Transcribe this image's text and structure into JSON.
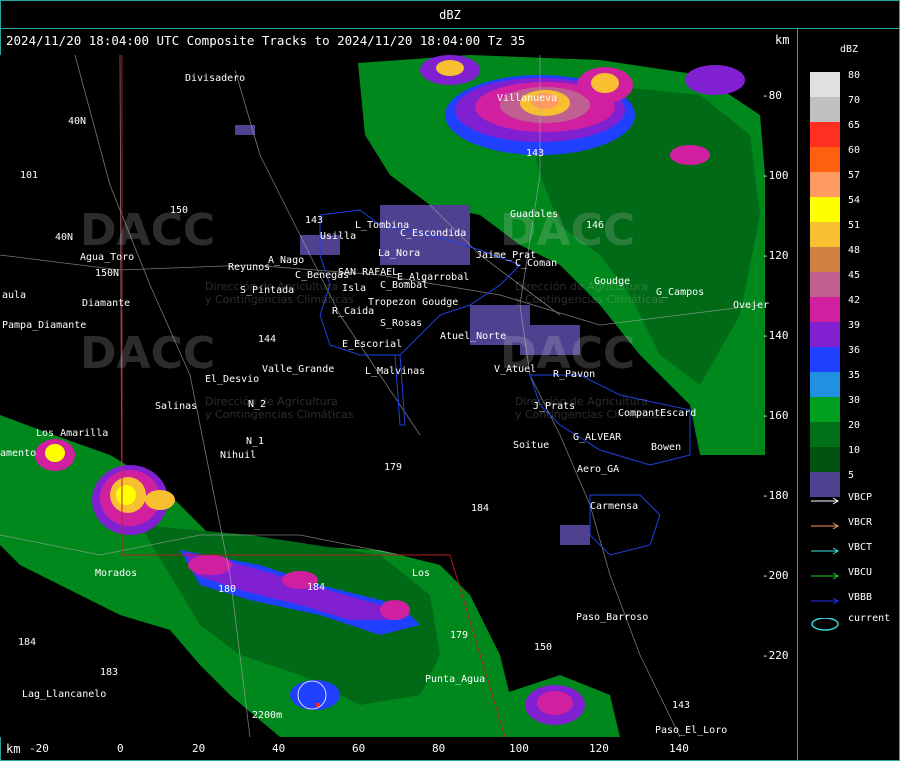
{
  "title_bar": "dBZ",
  "header": "2024/11/20 18:04:00 UTC Composite Tracks to 2024/11/20 18:04:00 Tz 35",
  "axis_unit": "km",
  "y_ticks": [
    "-80",
    "-100",
    "-120",
    "-140",
    "-160",
    "-180",
    "-200",
    "-220"
  ],
  "x_ticks": [
    "-20",
    "0",
    "20",
    "40",
    "60",
    "80",
    "100",
    "120",
    "140"
  ],
  "legend": {
    "unit": "dBZ",
    "levels": [
      {
        "label": "80",
        "color": "#e0e0e0"
      },
      {
        "label": "70",
        "color": "#c0c0c0"
      },
      {
        "label": "65",
        "color": "#ff3020"
      },
      {
        "label": "60",
        "color": "#ff6010"
      },
      {
        "label": "57",
        "color": "#ff9a60"
      },
      {
        "label": "54",
        "color": "#ffff00"
      },
      {
        "label": "51",
        "color": "#f8c030"
      },
      {
        "label": "48",
        "color": "#d08040"
      },
      {
        "label": "45",
        "color": "#c06090"
      },
      {
        "label": "42",
        "color": "#d020a0"
      },
      {
        "label": "39",
        "color": "#8020d0"
      },
      {
        "label": "36",
        "color": "#2040ff"
      },
      {
        "label": "35",
        "color": "#2090e0"
      },
      {
        "label": "30",
        "color": "#00a020"
      },
      {
        "label": "20",
        "color": "#007018"
      },
      {
        "label": "10",
        "color": "#005010"
      },
      {
        "label": "5",
        "color": "#504090"
      }
    ],
    "tracks": [
      {
        "label": "VBCP",
        "color": "#ffffff"
      },
      {
        "label": "VBCR",
        "color": "#ff9a60"
      },
      {
        "label": "VBCT",
        "color": "#40e0e0"
      },
      {
        "label": "VBCU",
        "color": "#20d020"
      },
      {
        "label": "VBBB",
        "color": "#2030ff"
      }
    ],
    "current_label": "current"
  },
  "place_labels": [
    {
      "text": "Divisadero"
    },
    {
      "text": "40N"
    },
    {
      "text": "101"
    },
    {
      "text": "40N"
    },
    {
      "text": "Agua_Toro"
    },
    {
      "text": "150N"
    },
    {
      "text": "aula"
    },
    {
      "text": "Pampa_Diamante"
    },
    {
      "text": "Diamante"
    },
    {
      "text": "150"
    },
    {
      "text": "143"
    },
    {
      "text": "L_Tombina"
    },
    {
      "text": "Usilla"
    },
    {
      "text": "La_Nora"
    },
    {
      "text": "C_Escondida"
    },
    {
      "text": "Reyunos"
    },
    {
      "text": "A_Nago"
    },
    {
      "text": "C_Benegas"
    },
    {
      "text": "SAN RAFAEL"
    },
    {
      "text": "E_Algarrobal"
    },
    {
      "text": "S_Pintada"
    },
    {
      "text": "Isla"
    },
    {
      "text": "C_Bombal"
    },
    {
      "text": "R_Caida"
    },
    {
      "text": "Tropezon Goudge"
    },
    {
      "text": "S_Rosas"
    },
    {
      "text": "Atuel_Norte"
    },
    {
      "text": "E_Escorial"
    },
    {
      "text": "144"
    },
    {
      "text": "El_Desvio"
    },
    {
      "text": "Valle_Grande"
    },
    {
      "text": "L_Malvinas"
    },
    {
      "text": "V_Atuel"
    },
    {
      "text": "R_Pavon"
    },
    {
      "text": "N_2"
    },
    {
      "text": "Salinas"
    },
    {
      "text": "J_Prats"
    },
    {
      "text": "CompantEscard"
    },
    {
      "text": "N_1"
    },
    {
      "text": "Nihuil"
    },
    {
      "text": "G_ALVEAR"
    },
    {
      "text": "Soitue"
    },
    {
      "text": "Bowen"
    },
    {
      "text": "Aero_GA"
    },
    {
      "text": "179"
    },
    {
      "text": "184"
    },
    {
      "text": "Carmensa"
    },
    {
      "text": "Los Amarilla"
    },
    {
      "text": "amento"
    },
    {
      "text": "Morados"
    },
    {
      "text": "180"
    },
    {
      "text": "184"
    },
    {
      "text": "Los"
    },
    {
      "text": "Paso_Barroso"
    },
    {
      "text": "184"
    },
    {
      "text": "150"
    },
    {
      "text": "179"
    },
    {
      "text": "183"
    },
    {
      "text": "Lag_Llancanelo"
    },
    {
      "text": "Punta_Agua"
    },
    {
      "text": "2200m"
    },
    {
      "text": "Paso_El_Loro"
    },
    {
      "text": "143"
    },
    {
      "text": "Villanueva"
    },
    {
      "text": "Guadales"
    },
    {
      "text": "Jaime_Prat"
    },
    {
      "text": "Goudge"
    },
    {
      "text": "G_Campos"
    },
    {
      "text": "Ovejer"
    },
    {
      "text": "146"
    },
    {
      "text": "C_Coman"
    },
    {
      "text": "143"
    }
  ],
  "watermark": {
    "logo": "DACC",
    "line1": "Dirección de Agricultura",
    "line2": "y Contingencias Climáticas"
  }
}
